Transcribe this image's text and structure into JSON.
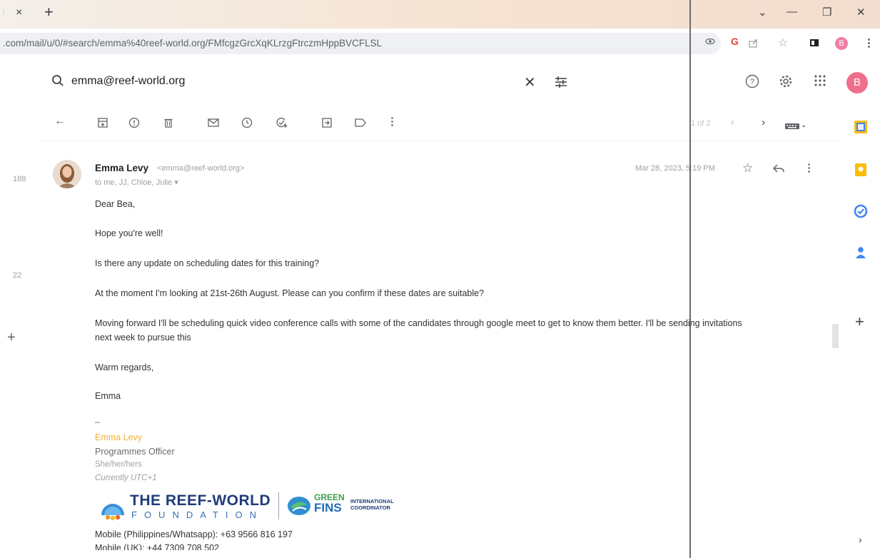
{
  "browser": {
    "tab_close": "×",
    "new_tab": "+",
    "window_controls": {
      "minimize": "—",
      "restore": "❐",
      "close": "✕",
      "dropdown": "⌄"
    },
    "url": ".com/mail/u/0/#search/emma%40reef-world.org/FMfcgzGrcXqKLrzgFtrczmHppBVCFLSL",
    "profile_initial": "B",
    "menu": "⋮"
  },
  "header": {
    "search_query": "emma@reef-world.org",
    "clear": "✕",
    "avatar_initial": "B"
  },
  "left_rail": {
    "count_a": "188",
    "count_b": "22",
    "add": "+"
  },
  "toolbar": {
    "pager_text": "1 of 2",
    "prev": "‹",
    "next": "›",
    "more": "⋮",
    "back": "←"
  },
  "message": {
    "sender_name": "Emma Levy",
    "sender_email": "<emma@reef-world.org>",
    "recipients": "to me, JJ, Chloe, Julie ▾",
    "date": "Mar 28, 2023, 5:19 PM",
    "more": "⋮",
    "body": [
      "Dear Bea,",
      "Hope you're well!",
      "Is there any update on scheduling dates for this training?",
      "At the moment I'm looking at 21st-26th August. Please can you confirm if these dates are suitable?",
      "Moving forward I'll be scheduling quick video conference calls with some of the candidates through google meet to get to know them better. I'll be sending invitations",
      "next week to pursue this",
      "Warm regards,",
      "Emma"
    ],
    "signature": {
      "dash": "–",
      "name": "Emma Levy",
      "role": "Programmes Officer",
      "pronouns": "She/her/hers",
      "timezone": "Currently UTC+1",
      "logo_title": "THE REEF-WORLD",
      "logo_sub": "FOUNDATION",
      "gf_green": "GREEN",
      "gf_fins": "FINS",
      "gf_coord": "INTERNATIONAL COORDINATOR",
      "mobile_ph": "Mobile (Philippines/Whatsapp): +63 9566 816 197",
      "mobile_uk": "Mobile (UK): +44 7309 708 502"
    }
  },
  "side_panel": {
    "add": "+",
    "expand": "›"
  },
  "colors": {
    "accent_pink": "#ee6f8c",
    "signature_name": "#f2b23b",
    "reef_blue": "#1f3d7a",
    "green_fins": "#38a34a"
  }
}
